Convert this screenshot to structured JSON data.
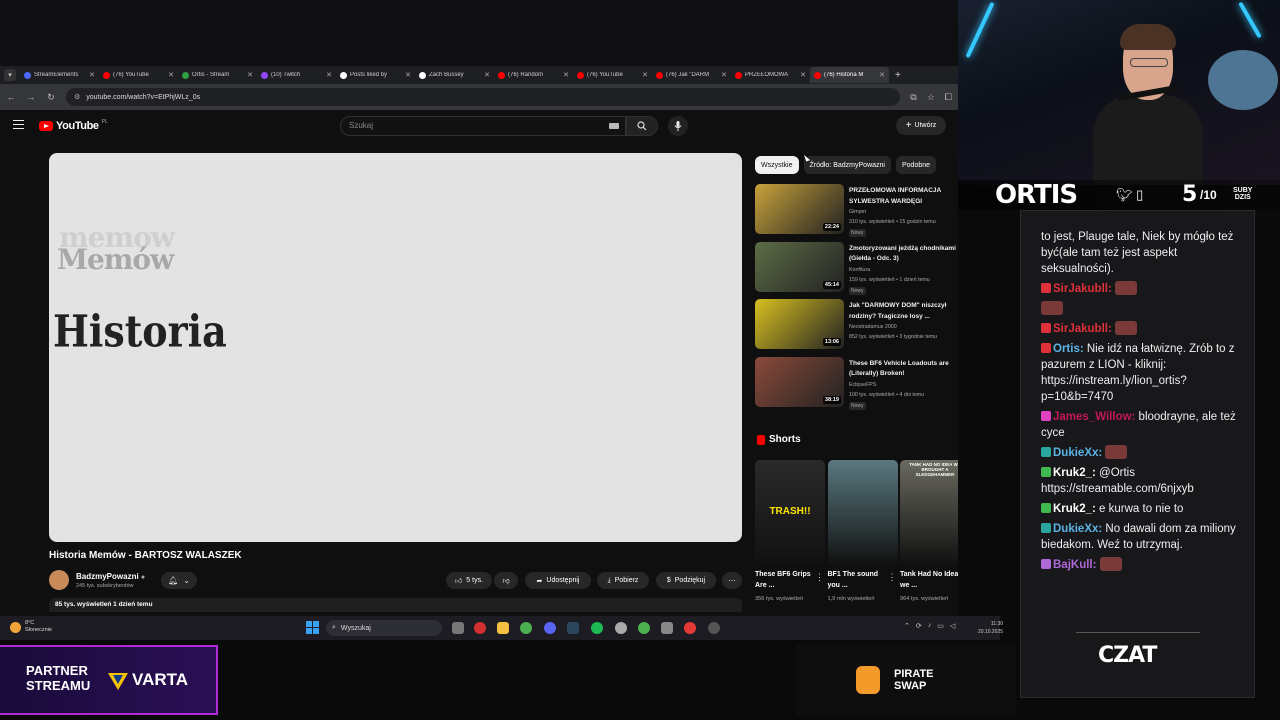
{
  "browser": {
    "tabs": [
      {
        "label": "StreamElements",
        "color": "#4b6bff"
      },
      {
        "label": "(76) YouTube",
        "color": "#ff0000"
      },
      {
        "label": "Ortis - Stream",
        "color": "#2ea043"
      },
      {
        "label": "(10) Twitch",
        "color": "#9146ff"
      },
      {
        "label": "Posts liked by",
        "color": "#ffffff"
      },
      {
        "label": "Zach Bussey",
        "color": "#ffffff"
      },
      {
        "label": "(76) Random",
        "color": "#ff0000"
      },
      {
        "label": "(76) YouTube",
        "color": "#ff0000"
      },
      {
        "label": "(76) Jak \"DARM",
        "color": "#ff0000"
      },
      {
        "label": "PRZEŁOMOWA",
        "color": "#ff0000"
      },
      {
        "label": "(76) Historia M",
        "color": "#ff0000"
      }
    ],
    "new_tab": "+",
    "url": "youtube.com/watch?v=EtPhjWLz_0s"
  },
  "youtube": {
    "logo": "YouTube",
    "logo_region": "PL",
    "search_placeholder": "Szukaj",
    "create_label": "Utwórz",
    "video_overlay": {
      "line1": "memow",
      "line2": "Memów",
      "line3": "Historia"
    },
    "video_title": "Historia Memów - BARTOSZ WALASZEK",
    "channel_name": "BadzmyPowazni",
    "channel_subs": "245 tys. subskrybentów",
    "likes": "5 tys.",
    "share": "Udostępnij",
    "download": "Pobierz",
    "thanks": "Podziękuj",
    "views_line": "85 tys. wyświetleń  1 dzień temu",
    "chips": [
      "Wszystkie",
      "Źródło: BadzmyPowazni",
      "Podobne"
    ],
    "recommended": [
      {
        "title": "PRZEŁOMOWA INFORMACJA SYLWESTRA WARDĘGI",
        "channel": "Gimper",
        "meta": "310 tys. wyświetleń • 15 godzin temu",
        "badge": "Nowy",
        "duration": "22:24",
        "thumb": "#c8a23a"
      },
      {
        "title": "Zmotoryzowani jeżdżą chodnikami (Giełda - Odc. 3)",
        "channel": "Konfitura",
        "meta": "159 tys. wyświetleń • 1 dzień temu",
        "badge": "Nowy",
        "duration": "45:14",
        "thumb": "#5d6d46"
      },
      {
        "title": "Jak \"DARMOWY DOM\" niszczył rodziny? Tragiczne losy ...",
        "channel": "Neostradamus 2000",
        "meta": "852 tys. wyświetleń • 3 tygodnie temu",
        "badge": "",
        "duration": "13:06",
        "thumb": "#d8c020"
      },
      {
        "title": "These BF6 Vehicle Loadouts are (Literally) Broken!",
        "channel": "EclipseFPS",
        "meta": "100 tys. wyświetleń • 4 dni temu",
        "badge": "Nowy",
        "duration": "38:19",
        "thumb": "#8a4a3a"
      }
    ],
    "shorts_title": "Shorts",
    "shorts": [
      {
        "title": "These BF6 Grips Are ...",
        "views": "356 tys. wyświetleń",
        "thumb": "#2a2a2a",
        "label": "TRASH!!"
      },
      {
        "title": "BF1 The sound you ...",
        "views": "1,9 mln wyświetleń",
        "thumb": "#5a7a80",
        "label": ""
      },
      {
        "title": "Tank Had No Idea we ...",
        "views": "964 tys. wyświetleń",
        "thumb": "#6a6a60",
        "label": "TANK HAD NO IDEA WE BROUGHT A SLEDGEHAMMER"
      }
    ]
  },
  "taskbar": {
    "temp": "8°C",
    "weather": "Słonecznie",
    "search": "Wyszukaj",
    "time": "11:30",
    "date": "20.10.2025"
  },
  "stream": {
    "name": "ORTIS",
    "subs_count": "5",
    "subs_goal": "/10",
    "subs_label_1": "SUBY",
    "subs_label_2": "DZIŚ",
    "chat_title": "CZAT",
    "partner_line1": "PARTNER",
    "partner_line2": "STREAMU",
    "partner_brand": "VARTA",
    "sponsor_line1": "PIRATE",
    "sponsor_line2": "SWAP"
  },
  "chat": [
    {
      "user": "",
      "text": "to jest, Plauge tale, Niek by mógło też być(ale tam też jest aspekt seksualności)."
    },
    {
      "user": "SirJakubll:",
      "text": ""
    },
    {
      "user": "",
      "text": ""
    },
    {
      "user": "SirJakubll:",
      "text": ""
    },
    {
      "user": "Ortis:",
      "text": "Nie idź na łatwiznę. Zrób to z pazurem z LION - kliknij: https://instream.ly/lion_ortis?p=10&b=7470"
    },
    {
      "user": "James_Willow:",
      "text": "bloodrayne, ale też cyce"
    },
    {
      "user": "DukieXx:",
      "text": ""
    },
    {
      "user": "Kruk2_:",
      "text": "@Ortis https://streamable.com/6njxyb"
    },
    {
      "user": "Kruk2_:",
      "text": "e kurwa to nie to"
    },
    {
      "user": "DukieXx:",
      "text": "No dawali dom za miliony biedakom. Weź to utrzymaj."
    },
    {
      "user": "BajKull:",
      "text": ""
    }
  ]
}
